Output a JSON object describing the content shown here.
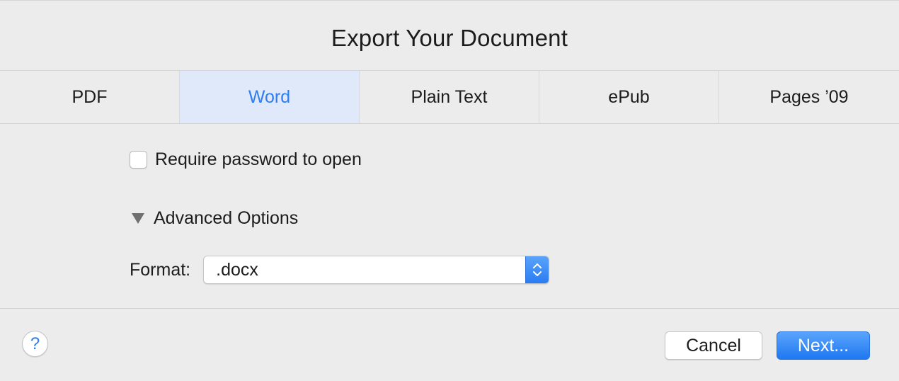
{
  "dialog": {
    "title": "Export Your Document"
  },
  "tabs": [
    {
      "label": "PDF",
      "selected": false
    },
    {
      "label": "Word",
      "selected": true
    },
    {
      "label": "Plain Text",
      "selected": false
    },
    {
      "label": "ePub",
      "selected": false
    },
    {
      "label": "Pages ’09",
      "selected": false
    }
  ],
  "options": {
    "password_checkbox": {
      "label": "Require password to open",
      "checked": false
    },
    "advanced": {
      "label": "Advanced Options",
      "expanded": true
    },
    "format": {
      "label": "Format:",
      "value": ".docx"
    }
  },
  "footer": {
    "help_label": "?",
    "cancel_label": "Cancel",
    "next_label": "Next..."
  },
  "colors": {
    "accent": "#2d7ef2",
    "selected_tab_bg": "#dfe9f9",
    "background": "#ececec"
  },
  "icons": {
    "disclosure": "disclosure-triangle-down-icon",
    "stepper": "up-down-chevron-icon",
    "help": "question-mark-icon"
  }
}
